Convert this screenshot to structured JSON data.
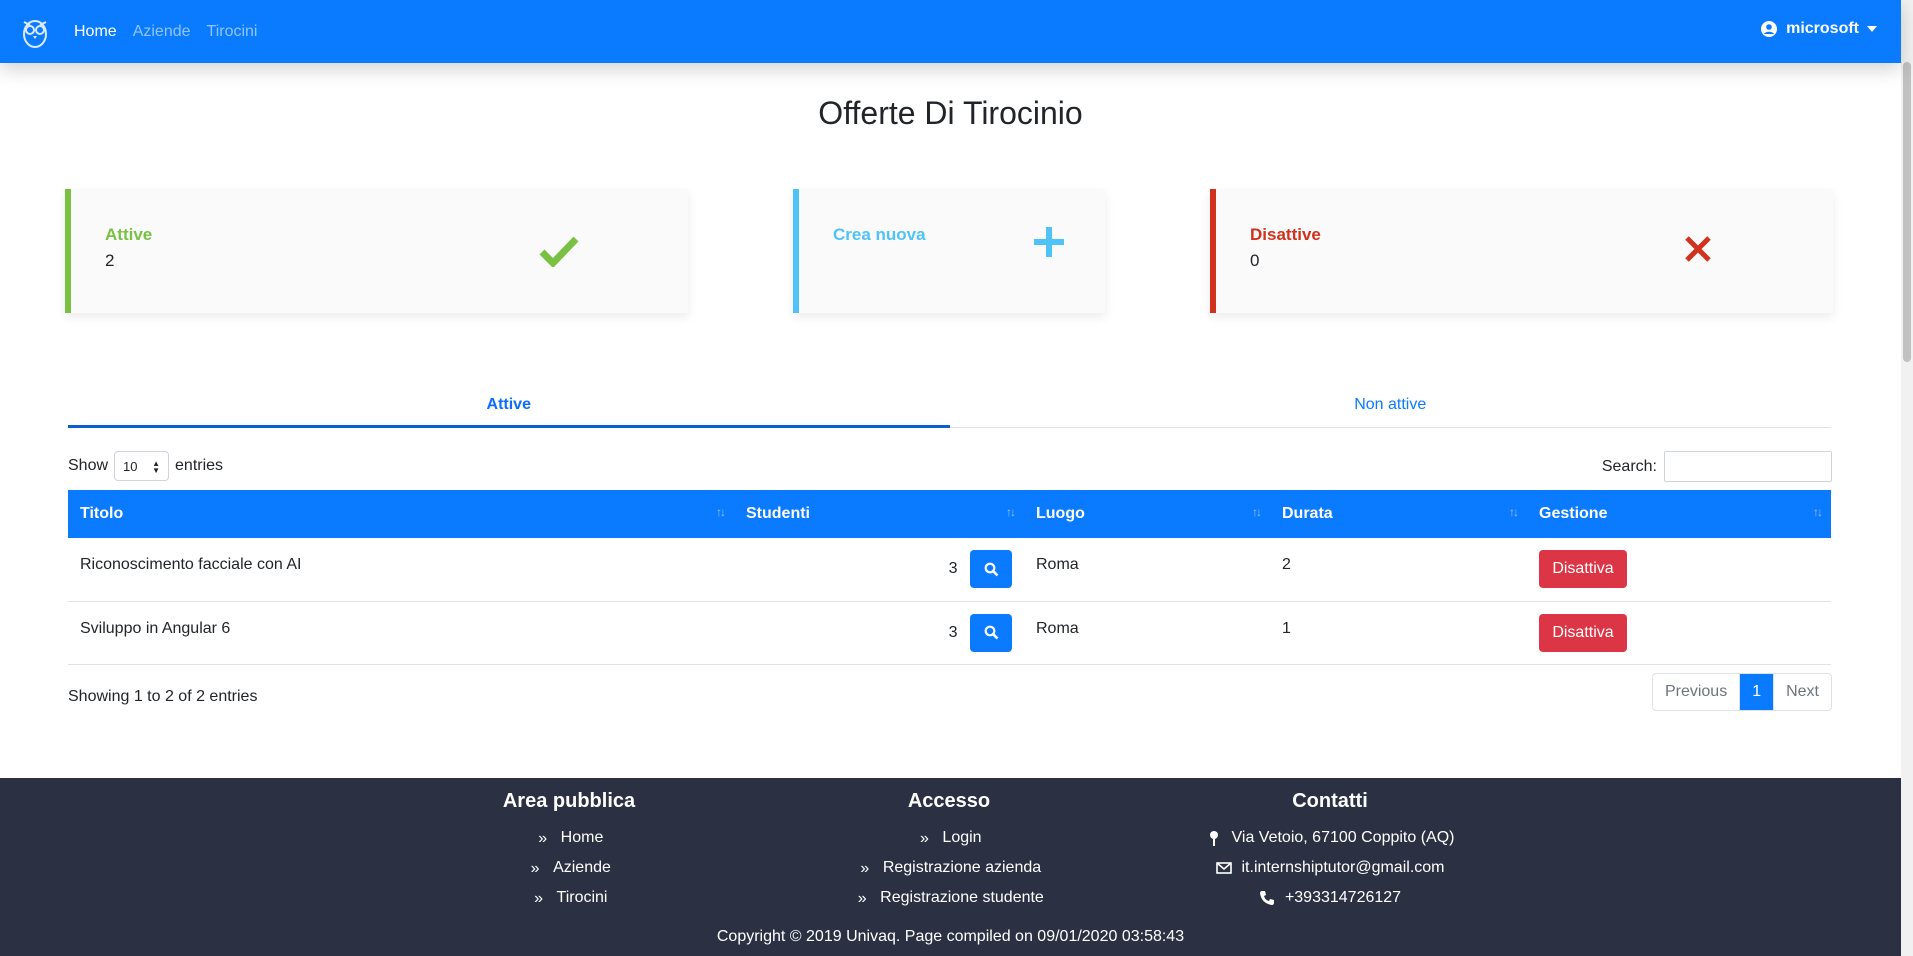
{
  "navbar": {
    "links": [
      "Home",
      "Aziende",
      "Tirocini"
    ],
    "user": "microsoft"
  },
  "page_title": "Offerte Di Tirocinio",
  "cards": {
    "active": {
      "label": "Attive",
      "value": "2",
      "color": "#7ac143"
    },
    "create": {
      "label": "Crea nuova",
      "color": "#4fc3f7"
    },
    "inactive": {
      "label": "Disattive",
      "value": "0",
      "color": "#d0321d"
    }
  },
  "tabs": [
    "Attive",
    "Non attive"
  ],
  "table_controls": {
    "show_label": "Show",
    "entries_label": "entries",
    "page_length": "10",
    "search_label": "Search:"
  },
  "table": {
    "headers": [
      "Titolo",
      "Studenti",
      "Luogo",
      "Durata",
      "Gestione"
    ],
    "rows": [
      {
        "titolo": "Riconoscimento facciale con AI",
        "studenti": "3",
        "luogo": "Roma",
        "durata": "2",
        "action": "Disattiva"
      },
      {
        "titolo": "Sviluppo in Angular 6",
        "studenti": "3",
        "luogo": "Roma",
        "durata": "1",
        "action": "Disattiva"
      }
    ]
  },
  "table_info": "Showing 1 to 2 of 2 entries",
  "pagination": {
    "previous": "Previous",
    "current": "1",
    "next": "Next"
  },
  "footer": {
    "public": {
      "title": "Area pubblica",
      "items": [
        "Home",
        "Aziende",
        "Tirocini"
      ]
    },
    "access": {
      "title": "Accesso",
      "items": [
        "Login",
        "Registrazione azienda",
        "Registrazione studente"
      ]
    },
    "contacts": {
      "title": "Contatti",
      "items": [
        "Via Vetoio, 67100 Coppito (AQ)",
        "it.internshiptutor@gmail.com",
        "+393314726127"
      ]
    },
    "copyright": "Copyright © 2019 Univaq. Page compiled on 09/01/2020 03:58:43"
  },
  "colors": {
    "primary": "#0a7bff",
    "danger": "#dc3545",
    "footer": "#2b3142"
  }
}
